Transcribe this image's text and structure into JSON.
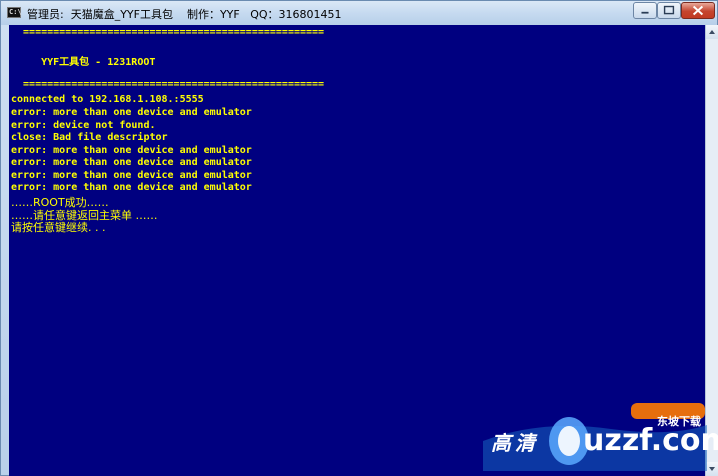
{
  "window": {
    "title": "管理员:  天猫魔盒_YYF工具包    制作：YYF   QQ：316801451",
    "icon_label": "C:\\",
    "controls": [
      "minimize-icon",
      "maximize-icon",
      "close-icon"
    ]
  },
  "console": {
    "text_color": "#ffff00",
    "bg_color": "#000080",
    "lines": [
      "  ==================================================",
      "",
      "     YYF工具包 - 1231ROOT",
      "",
      "  ==================================================",
      "connected to 192.168.1.108.:5555",
      "error: more than one device and emulator",
      "error: device not found.",
      "close: Bad file descriptor",
      "error: more than one device and emulator",
      "error: more than one device and emulator",
      "error: more than one device and emulator",
      "error: more than one device and emulator",
      "……ROOT成功……",
      "……请任意键返回主菜单 ……",
      "请按任意键继续. . ."
    ]
  },
  "watermark": {
    "left_text": "高清",
    "right_text": "uzzf.com",
    "badge": "东坡下载"
  }
}
